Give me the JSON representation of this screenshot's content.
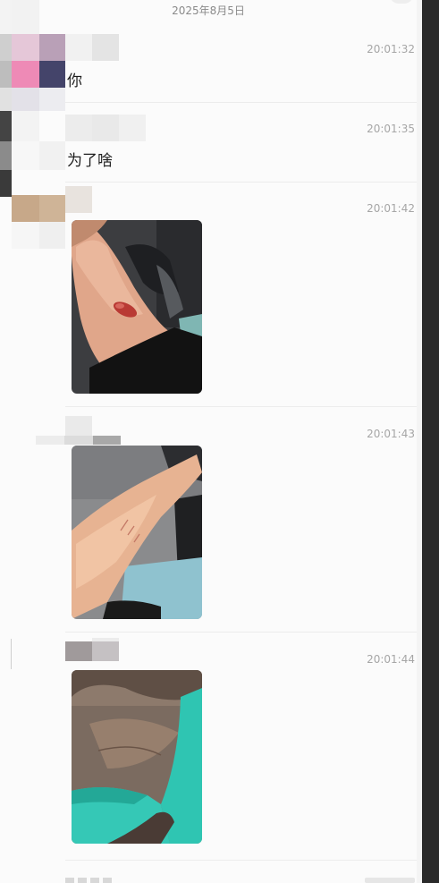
{
  "chat": {
    "date_header": "2025年8月5日",
    "messages": [
      {
        "sender": "",
        "time": "20:01:32",
        "type": "text",
        "text": "你"
      },
      {
        "sender": "",
        "time": "20:01:35",
        "type": "text",
        "text": "为了啥"
      },
      {
        "sender": "",
        "time": "20:01:42",
        "type": "image"
      },
      {
        "sender": "",
        "time": "20:01:43",
        "type": "image"
      },
      {
        "sender": "",
        "time": "20:01:44",
        "type": "image"
      }
    ]
  },
  "colors": {
    "background": "#fbfbfb",
    "timestamp": "#a6a6a6",
    "message_text": "#1e1e1e",
    "divider": "#ececec",
    "right_edge": "#2a2a2a"
  }
}
